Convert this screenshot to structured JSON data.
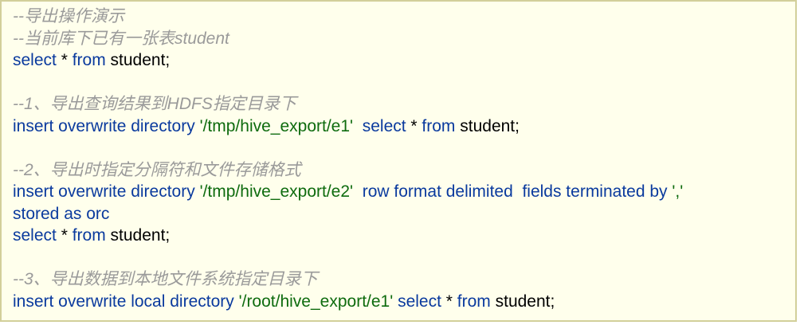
{
  "lines": [
    {
      "type": "code",
      "tokens": [
        {
          "c": "comment",
          "t": "--导出操作演示"
        }
      ]
    },
    {
      "type": "code",
      "tokens": [
        {
          "c": "comment",
          "t": "--当前库下已有一张表student"
        }
      ]
    },
    {
      "type": "code",
      "tokens": [
        {
          "c": "kw",
          "t": "select"
        },
        {
          "c": "plain",
          "t": " * "
        },
        {
          "c": "kw",
          "t": "from"
        },
        {
          "c": "plain",
          "t": " student;"
        }
      ]
    },
    {
      "type": "blank"
    },
    {
      "type": "code",
      "tokens": [
        {
          "c": "comment",
          "t": "--1、导出查询结果到HDFS指定目录下"
        }
      ]
    },
    {
      "type": "code",
      "tokens": [
        {
          "c": "kw",
          "t": "insert overwrite directory "
        },
        {
          "c": "str",
          "t": "'/tmp/hive_export/e1'"
        },
        {
          "c": "plain",
          "t": "  "
        },
        {
          "c": "kw",
          "t": "select"
        },
        {
          "c": "plain",
          "t": " * "
        },
        {
          "c": "kw",
          "t": "from"
        },
        {
          "c": "plain",
          "t": " student;"
        }
      ]
    },
    {
      "type": "blank"
    },
    {
      "type": "code",
      "tokens": [
        {
          "c": "comment",
          "t": "--2、导出时指定分隔符和文件存储格式"
        }
      ]
    },
    {
      "type": "code",
      "tokens": [
        {
          "c": "kw",
          "t": "insert overwrite directory "
        },
        {
          "c": "str",
          "t": "'/tmp/hive_export/e2'"
        },
        {
          "c": "plain",
          "t": "  "
        },
        {
          "c": "kw",
          "t": "row format delimited  fields terminated by "
        },
        {
          "c": "str",
          "t": "','"
        }
      ]
    },
    {
      "type": "code",
      "tokens": [
        {
          "c": "kw",
          "t": "stored as orc"
        }
      ]
    },
    {
      "type": "code",
      "tokens": [
        {
          "c": "kw",
          "t": "select"
        },
        {
          "c": "plain",
          "t": " * "
        },
        {
          "c": "kw",
          "t": "from"
        },
        {
          "c": "plain",
          "t": " student;"
        }
      ]
    },
    {
      "type": "blank"
    },
    {
      "type": "code",
      "tokens": [
        {
          "c": "comment",
          "t": "--3、导出数据到本地文件系统指定目录下"
        }
      ]
    },
    {
      "type": "code",
      "tokens": [
        {
          "c": "kw",
          "t": "insert overwrite local directory "
        },
        {
          "c": "str",
          "t": "'/root/hive_export/e1'"
        },
        {
          "c": "plain",
          "t": " "
        },
        {
          "c": "kw",
          "t": "select"
        },
        {
          "c": "plain",
          "t": " * "
        },
        {
          "c": "kw",
          "t": "from"
        },
        {
          "c": "plain",
          "t": " student;"
        }
      ]
    }
  ],
  "colors": {
    "background": "#ffffec",
    "border": "#d2cf9a",
    "comment": "#9a9a9a",
    "keyword": "#0a3a9e",
    "string": "#0e6b0e",
    "text": "#000000"
  }
}
